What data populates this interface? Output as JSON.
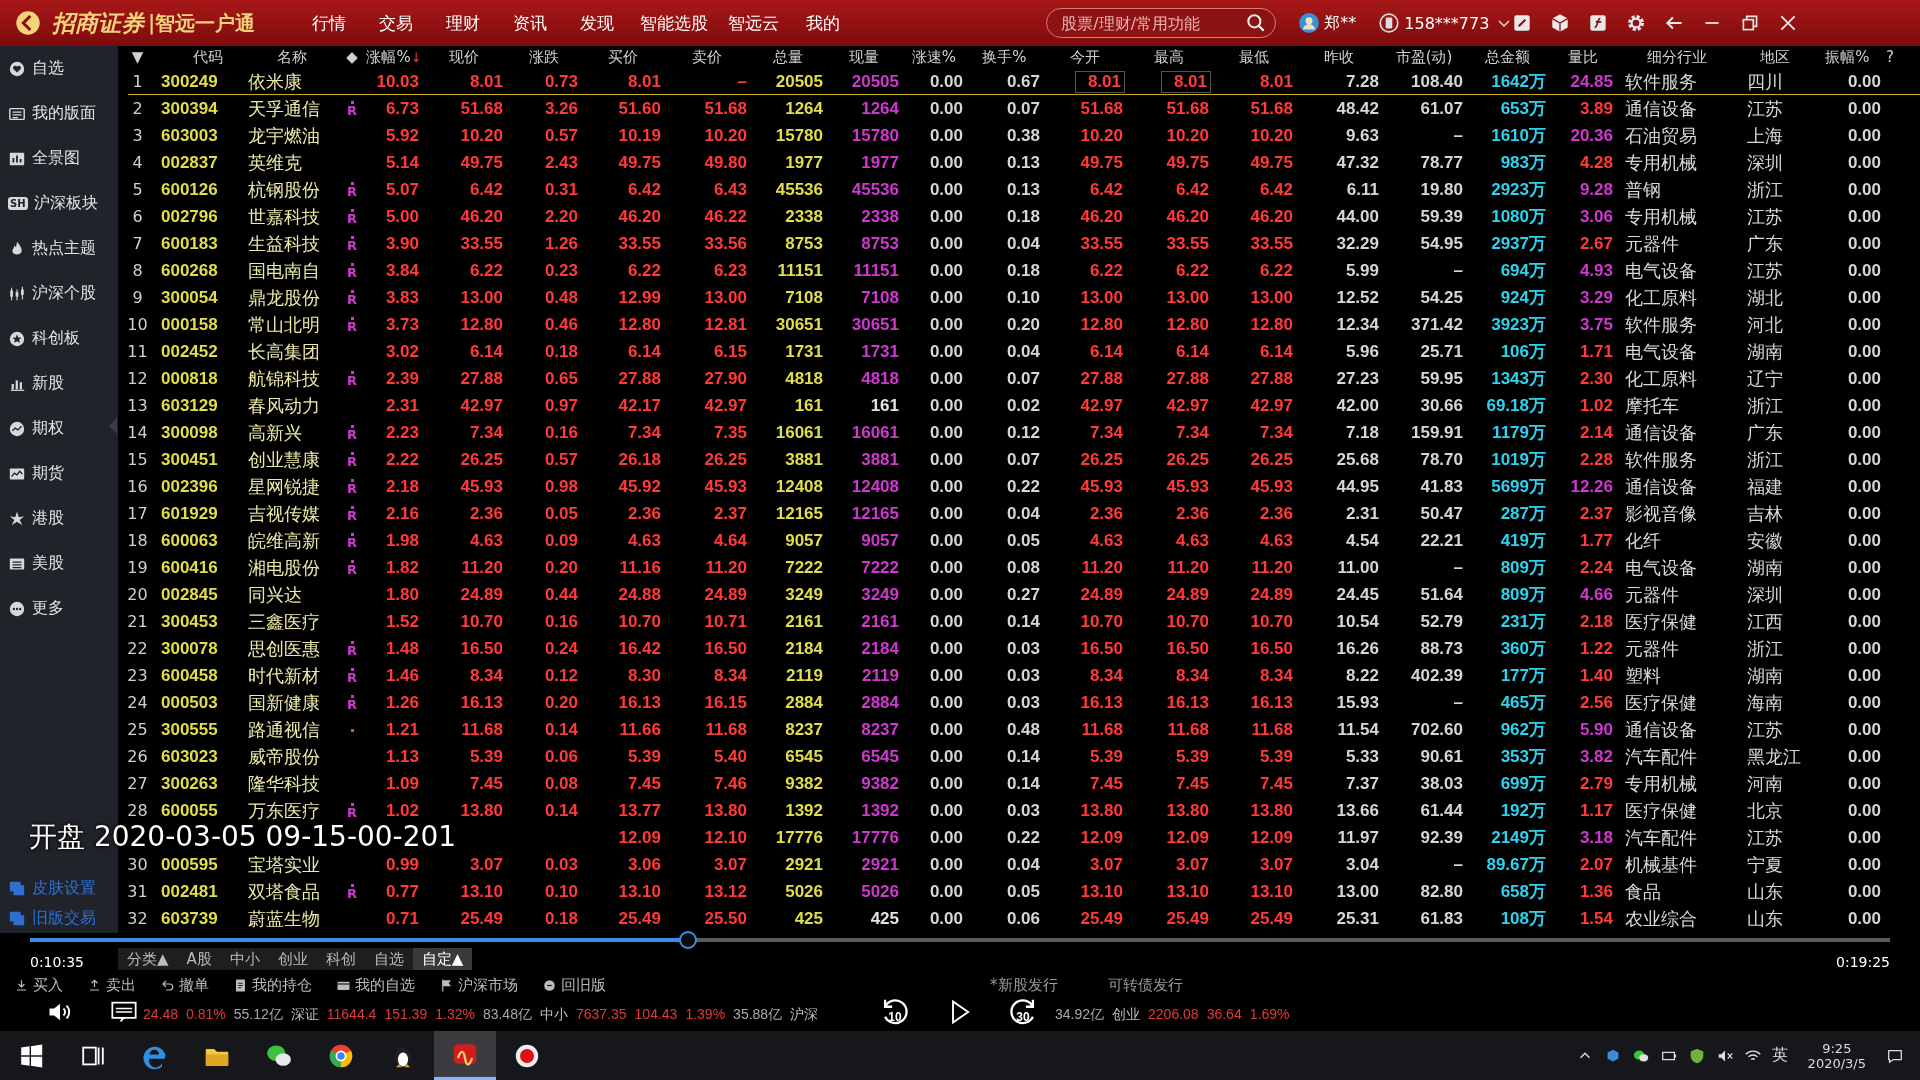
{
  "title_bar": {
    "brand": "招商证券",
    "product": "|智远一户通",
    "menu": [
      {
        "label": "行情",
        "selected": false
      },
      {
        "label": "交易",
        "selected": false
      },
      {
        "label": "理财",
        "selected": false
      },
      {
        "label": "资讯",
        "selected": false
      },
      {
        "label": "发现",
        "selected": false
      },
      {
        "label": "智能选股",
        "selected": false
      },
      {
        "label": "智远云",
        "selected": false
      },
      {
        "label": "我的",
        "selected": false
      }
    ],
    "search": {
      "placeholder": "股票/理财/常用功能"
    },
    "user": "郑**",
    "phone": "158***773"
  },
  "sidebar": {
    "items": [
      {
        "label": "自选",
        "kind": "heart"
      },
      {
        "label": "我的版面",
        "kind": "panel"
      },
      {
        "label": "全景图",
        "kind": "bars"
      },
      {
        "label": "沪深板块",
        "badge": "SH"
      },
      {
        "label": "热点主题",
        "kind": "flame"
      },
      {
        "label": "沪深个股",
        "kind": "candles"
      },
      {
        "label": "科创板",
        "kind": "star"
      },
      {
        "label": "新股",
        "kind": "chart"
      },
      {
        "label": "期权",
        "kind": "trend"
      },
      {
        "label": "期货",
        "kind": "area"
      },
      {
        "label": "港股",
        "kind": "flower"
      },
      {
        "label": "美股",
        "kind": "list"
      },
      {
        "label": "更多",
        "kind": "more"
      }
    ],
    "bottom_items": [
      {
        "label": "皮肤设置",
        "kind": "skin"
      },
      {
        "label": "旧版交易",
        "kind": "skin"
      }
    ]
  },
  "table": {
    "help": "?",
    "columns": [
      {
        "label": "▼",
        "kind": "rank"
      },
      {
        "label": "代码",
        "kind": "code"
      },
      {
        "label": "名称",
        "kind": "name"
      },
      {
        "label": "◆",
        "kind": "flag"
      },
      {
        "label": "涨幅%",
        "kind": "up",
        "sort": "↓"
      },
      {
        "label": "现价",
        "kind": "up"
      },
      {
        "label": "涨跌",
        "kind": "up"
      },
      {
        "label": "买价",
        "kind": "up"
      },
      {
        "label": "卖价",
        "kind": "up"
      },
      {
        "label": "总量",
        "kind": "volume"
      },
      {
        "label": "现量",
        "kind": "now"
      },
      {
        "label": "涨速%",
        "kind": "plain"
      },
      {
        "label": "换手%",
        "kind": "plain"
      },
      {
        "label": "今开",
        "kind": "up",
        "focus": true
      },
      {
        "label": "最高",
        "kind": "up",
        "focus": true
      },
      {
        "label": "最低",
        "kind": "up"
      },
      {
        "label": "昨收",
        "kind": "plain"
      },
      {
        "label": "市盈(动)",
        "kind": "plain"
      },
      {
        "label": "总金额",
        "kind": "amount"
      },
      {
        "label": "量比",
        "kind": "ratio"
      },
      {
        "label": "细分行业",
        "kind": "text"
      },
      {
        "label": "地区",
        "kind": "text"
      },
      {
        "label": "振幅%",
        "kind": "plain"
      }
    ],
    "rows": [
      {
        "cells": [
          "1",
          "300249",
          "依米康",
          "",
          "10.03",
          "8.01",
          "0.73",
          "8.01",
          "–",
          "20505",
          "20505",
          "0.00",
          "0.67",
          "8.01",
          "8.01",
          "8.01",
          "7.28",
          "108.40",
          "1642万",
          "24.85",
          "软件服务",
          "四川",
          "0.00"
        ],
        "selected": true,
        "dot": false,
        "now_flat": false,
        "ratio_high": true
      },
      {
        "cells": [
          "2",
          "300394",
          "天孚通信",
          "R",
          "6.73",
          "51.68",
          "3.26",
          "51.60",
          "51.68",
          "1264",
          "1264",
          "0.00",
          "0.07",
          "51.68",
          "51.68",
          "51.68",
          "48.42",
          "61.07",
          "653万",
          "3.89",
          "通信设备",
          "江苏",
          "0.00"
        ],
        "selected": false,
        "dot": true,
        "now_flat": false,
        "ratio_high": false
      },
      {
        "cells": [
          "3",
          "603003",
          "龙宇燃油",
          "",
          "5.92",
          "10.20",
          "0.57",
          "10.19",
          "10.20",
          "15780",
          "15780",
          "0.00",
          "0.38",
          "10.20",
          "10.20",
          "10.20",
          "9.63",
          "–",
          "1610万",
          "20.36",
          "石油贸易",
          "上海",
          "0.00"
        ],
        "selected": false,
        "dot": false,
        "now_flat": false,
        "ratio_high": true
      },
      {
        "cells": [
          "4",
          "002837",
          "英维克",
          "",
          "5.14",
          "49.75",
          "2.43",
          "49.75",
          "49.80",
          "1977",
          "1977",
          "0.00",
          "0.13",
          "49.75",
          "49.75",
          "49.75",
          "47.32",
          "78.77",
          "983万",
          "4.28",
          "专用机械",
          "深圳",
          "0.00"
        ],
        "selected": false,
        "dot": false,
        "now_flat": false,
        "ratio_high": false
      },
      {
        "cells": [
          "5",
          "600126",
          "杭钢股份",
          "R",
          "5.07",
          "6.42",
          "0.31",
          "6.42",
          "6.43",
          "45536",
          "45536",
          "0.00",
          "0.13",
          "6.42",
          "6.42",
          "6.42",
          "6.11",
          "19.80",
          "2923万",
          "9.28",
          "普钢",
          "浙江",
          "0.00"
        ],
        "selected": false,
        "dot": true,
        "now_flat": false,
        "ratio_high": true
      },
      {
        "cells": [
          "6",
          "002796",
          "世嘉科技",
          "R",
          "5.00",
          "46.20",
          "2.20",
          "46.20",
          "46.22",
          "2338",
          "2338",
          "0.00",
          "0.18",
          "46.20",
          "46.20",
          "46.20",
          "44.00",
          "59.39",
          "1080万",
          "3.06",
          "专用机械",
          "江苏",
          "0.00"
        ],
        "selected": false,
        "dot": true,
        "now_flat": false,
        "ratio_high": true
      },
      {
        "cells": [
          "7",
          "600183",
          "生益科技",
          "R",
          "3.90",
          "33.55",
          "1.26",
          "33.55",
          "33.56",
          "8753",
          "8753",
          "0.00",
          "0.04",
          "33.55",
          "33.55",
          "33.55",
          "32.29",
          "54.95",
          "2937万",
          "2.67",
          "元器件",
          "广东",
          "0.00"
        ],
        "selected": false,
        "dot": true,
        "now_flat": false,
        "ratio_high": false
      },
      {
        "cells": [
          "8",
          "600268",
          "国电南自",
          "R",
          "3.84",
          "6.22",
          "0.23",
          "6.22",
          "6.23",
          "11151",
          "11151",
          "0.00",
          "0.18",
          "6.22",
          "6.22",
          "6.22",
          "5.99",
          "–",
          "694万",
          "4.93",
          "电气设备",
          "江苏",
          "0.00"
        ],
        "selected": false,
        "dot": true,
        "now_flat": false,
        "ratio_high": true
      },
      {
        "cells": [
          "9",
          "300054",
          "鼎龙股份",
          "R",
          "3.83",
          "13.00",
          "0.48",
          "12.99",
          "13.00",
          "7108",
          "7108",
          "0.00",
          "0.10",
          "13.00",
          "13.00",
          "13.00",
          "12.52",
          "54.25",
          "924万",
          "3.29",
          "化工原料",
          "湖北",
          "0.00"
        ],
        "selected": false,
        "dot": true,
        "now_flat": false,
        "ratio_high": true
      },
      {
        "cells": [
          "10",
          "000158",
          "常山北明",
          "R",
          "3.73",
          "12.80",
          "0.46",
          "12.80",
          "12.81",
          "30651",
          "30651",
          "0.00",
          "0.20",
          "12.80",
          "12.80",
          "12.80",
          "12.34",
          "371.42",
          "3923万",
          "3.75",
          "软件服务",
          "河北",
          "0.00"
        ],
        "selected": false,
        "dot": true,
        "now_flat": false,
        "ratio_high": true
      },
      {
        "cells": [
          "11",
          "002452",
          "长高集团",
          "",
          "3.02",
          "6.14",
          "0.18",
          "6.14",
          "6.15",
          "1731",
          "1731",
          "0.00",
          "0.04",
          "6.14",
          "6.14",
          "6.14",
          "5.96",
          "25.71",
          "106万",
          "1.71",
          "电气设备",
          "湖南",
          "0.00"
        ],
        "selected": false,
        "dot": false,
        "now_flat": false,
        "ratio_high": false
      },
      {
        "cells": [
          "12",
          "000818",
          "航锦科技",
          "R",
          "2.39",
          "27.88",
          "0.65",
          "27.88",
          "27.90",
          "4818",
          "4818",
          "0.00",
          "0.07",
          "27.88",
          "27.88",
          "27.88",
          "27.23",
          "59.95",
          "1343万",
          "2.30",
          "化工原料",
          "辽宁",
          "0.00"
        ],
        "selected": false,
        "dot": true,
        "now_flat": false,
        "ratio_high": false
      },
      {
        "cells": [
          "13",
          "603129",
          "春风动力",
          "",
          "2.31",
          "42.97",
          "0.97",
          "42.17",
          "42.97",
          "161",
          "161",
          "0.00",
          "0.02",
          "42.97",
          "42.97",
          "42.97",
          "42.00",
          "30.66",
          "69.18万",
          "1.02",
          "摩托车",
          "浙江",
          "0.00"
        ],
        "selected": false,
        "dot": false,
        "now_flat": true,
        "ratio_high": false
      },
      {
        "cells": [
          "14",
          "300098",
          "高新兴",
          "R",
          "2.23",
          "7.34",
          "0.16",
          "7.34",
          "7.35",
          "16061",
          "16061",
          "0.00",
          "0.12",
          "7.34",
          "7.34",
          "7.34",
          "7.18",
          "159.91",
          "1179万",
          "2.14",
          "通信设备",
          "广东",
          "0.00"
        ],
        "selected": false,
        "dot": true,
        "now_flat": false,
        "ratio_high": false
      },
      {
        "cells": [
          "15",
          "300451",
          "创业慧康",
          "R",
          "2.22",
          "26.25",
          "0.57",
          "26.18",
          "26.25",
          "3881",
          "3881",
          "0.00",
          "0.07",
          "26.25",
          "26.25",
          "26.25",
          "25.68",
          "78.70",
          "1019万",
          "2.28",
          "软件服务",
          "浙江",
          "0.00"
        ],
        "selected": false,
        "dot": true,
        "now_flat": false,
        "ratio_high": false
      },
      {
        "cells": [
          "16",
          "002396",
          "星网锐捷",
          "R",
          "2.18",
          "45.93",
          "0.98",
          "45.92",
          "45.93",
          "12408",
          "12408",
          "0.00",
          "0.22",
          "45.93",
          "45.93",
          "45.93",
          "44.95",
          "41.83",
          "5699万",
          "12.26",
          "通信设备",
          "福建",
          "0.00"
        ],
        "selected": false,
        "dot": true,
        "now_flat": false,
        "ratio_high": true
      },
      {
        "cells": [
          "17",
          "601929",
          "吉视传媒",
          "R",
          "2.16",
          "2.36",
          "0.05",
          "2.36",
          "2.37",
          "12165",
          "12165",
          "0.00",
          "0.04",
          "2.36",
          "2.36",
          "2.36",
          "2.31",
          "50.47",
          "287万",
          "2.37",
          "影视音像",
          "吉林",
          "0.00"
        ],
        "selected": false,
        "dot": true,
        "now_flat": false,
        "ratio_high": false
      },
      {
        "cells": [
          "18",
          "600063",
          "皖维高新",
          "R",
          "1.98",
          "4.63",
          "0.09",
          "4.63",
          "4.64",
          "9057",
          "9057",
          "0.00",
          "0.05",
          "4.63",
          "4.63",
          "4.63",
          "4.54",
          "22.21",
          "419万",
          "1.77",
          "化纤",
          "安徽",
          "0.00"
        ],
        "selected": false,
        "dot": true,
        "now_flat": false,
        "ratio_high": false
      },
      {
        "cells": [
          "19",
          "600416",
          "湘电股份",
          "R",
          "1.82",
          "11.20",
          "0.20",
          "11.16",
          "11.20",
          "7222",
          "7222",
          "0.00",
          "0.08",
          "11.20",
          "11.20",
          "11.20",
          "11.00",
          "–",
          "809万",
          "2.24",
          "电气设备",
          "湖南",
          "0.00"
        ],
        "selected": false,
        "dot": true,
        "now_flat": false,
        "ratio_high": false
      },
      {
        "cells": [
          "20",
          "002845",
          "同兴达",
          "",
          "1.80",
          "24.89",
          "0.44",
          "24.88",
          "24.89",
          "3249",
          "3249",
          "0.00",
          "0.27",
          "24.89",
          "24.89",
          "24.89",
          "24.45",
          "51.64",
          "809万",
          "4.66",
          "元器件",
          "深圳",
          "0.00"
        ],
        "selected": false,
        "dot": false,
        "now_flat": false,
        "ratio_high": true
      },
      {
        "cells": [
          "21",
          "300453",
          "三鑫医疗",
          "",
          "1.52",
          "10.70",
          "0.16",
          "10.70",
          "10.71",
          "2161",
          "2161",
          "0.00",
          "0.14",
          "10.70",
          "10.70",
          "10.70",
          "10.54",
          "52.79",
          "231万",
          "2.18",
          "医疗保健",
          "江西",
          "0.00"
        ],
        "selected": false,
        "dot": false,
        "now_flat": false,
        "ratio_high": false
      },
      {
        "cells": [
          "22",
          "300078",
          "思创医惠",
          "R",
          "1.48",
          "16.50",
          "0.24",
          "16.42",
          "16.50",
          "2184",
          "2184",
          "0.00",
          "0.03",
          "16.50",
          "16.50",
          "16.50",
          "16.26",
          "88.73",
          "360万",
          "1.22",
          "元器件",
          "浙江",
          "0.00"
        ],
        "selected": false,
        "dot": true,
        "now_flat": false,
        "ratio_high": false
      },
      {
        "cells": [
          "23",
          "600458",
          "时代新材",
          "R",
          "1.46",
          "8.34",
          "0.12",
          "8.30",
          "8.34",
          "2119",
          "2119",
          "0.00",
          "0.03",
          "8.34",
          "8.34",
          "8.34",
          "8.22",
          "402.39",
          "177万",
          "1.40",
          "塑料",
          "湖南",
          "0.00"
        ],
        "selected": false,
        "dot": true,
        "now_flat": false,
        "ratio_high": false
      },
      {
        "cells": [
          "24",
          "000503",
          "国新健康",
          "R",
          "1.26",
          "16.13",
          "0.20",
          "16.13",
          "16.15",
          "2884",
          "2884",
          "0.00",
          "0.03",
          "16.13",
          "16.13",
          "16.13",
          "15.93",
          "–",
          "465万",
          "2.56",
          "医疗保健",
          "海南",
          "0.00"
        ],
        "selected": false,
        "dot": true,
        "now_flat": false,
        "ratio_high": false
      },
      {
        "cells": [
          "25",
          "300555",
          "路通视信",
          "",
          "1.21",
          "11.68",
          "0.14",
          "11.66",
          "11.68",
          "8237",
          "8237",
          "0.00",
          "0.48",
          "11.68",
          "11.68",
          "11.68",
          "11.54",
          "702.60",
          "962万",
          "5.90",
          "通信设备",
          "江苏",
          "0.00"
        ],
        "selected": false,
        "dot": true,
        "now_flat": false,
        "ratio_high": true
      },
      {
        "cells": [
          "26",
          "603023",
          "威帝股份",
          "",
          "1.13",
          "5.39",
          "0.06",
          "5.39",
          "5.40",
          "6545",
          "6545",
          "0.00",
          "0.14",
          "5.39",
          "5.39",
          "5.39",
          "5.33",
          "90.61",
          "353万",
          "3.82",
          "汽车配件",
          "黑龙江",
          "0.00"
        ],
        "selected": false,
        "dot": false,
        "now_flat": false,
        "ratio_high": true
      },
      {
        "cells": [
          "27",
          "300263",
          "隆华科技",
          "",
          "1.09",
          "7.45",
          "0.08",
          "7.45",
          "7.46",
          "9382",
          "9382",
          "0.00",
          "0.14",
          "7.45",
          "7.45",
          "7.45",
          "7.37",
          "38.03",
          "699万",
          "2.79",
          "专用机械",
          "河南",
          "0.00"
        ],
        "selected": false,
        "dot": false,
        "now_flat": false,
        "ratio_high": false
      },
      {
        "cells": [
          "28",
          "600055",
          "万东医疗",
          "R",
          "1.02",
          "13.80",
          "0.14",
          "13.77",
          "13.80",
          "1392",
          "1392",
          "0.00",
          "0.03",
          "13.80",
          "13.80",
          "13.80",
          "13.66",
          "61.44",
          "192万",
          "1.17",
          "医疗保健",
          "北京",
          "0.00"
        ],
        "selected": false,
        "dot": true,
        "now_flat": false,
        "ratio_high": false
      },
      {
        "cells": [
          null,
          null,
          null,
          null,
          null,
          null,
          null,
          "12.09",
          "12.10",
          "17776",
          "17776",
          "0.00",
          "0.22",
          "12.09",
          "12.09",
          "12.09",
          "11.97",
          "92.39",
          "2149万",
          "3.18",
          "汽车配件",
          "江苏",
          "0.00"
        ],
        "selected": false,
        "dot": false,
        "now_flat": false,
        "ratio_high": true
      },
      {
        "cells": [
          "30",
          "000595",
          "宝塔实业",
          "",
          "0.99",
          "3.07",
          "0.03",
          "3.06",
          "3.07",
          "2921",
          "2921",
          "0.00",
          "0.04",
          "3.07",
          "3.07",
          "3.07",
          "3.04",
          "–",
          "89.67万",
          "2.07",
          "机械基件",
          "宁夏",
          "0.00"
        ],
        "selected": false,
        "dot": false,
        "now_flat": false,
        "ratio_high": false
      },
      {
        "cells": [
          "31",
          "002481",
          "双塔食品",
          "R",
          "0.77",
          "13.10",
          "0.10",
          "13.10",
          "13.12",
          "5026",
          "5026",
          "0.00",
          "0.05",
          "13.10",
          "13.10",
          "13.10",
          "13.00",
          "82.80",
          "658万",
          "1.36",
          "食品",
          "山东",
          "0.00"
        ],
        "selected": false,
        "dot": true,
        "now_flat": false,
        "ratio_high": false
      },
      {
        "cells": [
          "32",
          "603739",
          "蔚蓝生物",
          "",
          "0.71",
          "25.49",
          "0.18",
          "25.49",
          "25.50",
          "425",
          "425",
          "0.00",
          "0.06",
          "25.49",
          "25.49",
          "25.49",
          "25.31",
          "61.83",
          "108万",
          "1.54",
          "农业综合",
          "山东",
          "0.00"
        ],
        "selected": false,
        "dot": false,
        "now_flat": true,
        "ratio_high": false
      }
    ]
  },
  "market_tabs": [
    {
      "label": "分类▲",
      "selected": false
    },
    {
      "label": "A股",
      "selected": false
    },
    {
      "label": "中小",
      "selected": false
    },
    {
      "label": "创业",
      "selected": false
    },
    {
      "label": "科创",
      "selected": false
    },
    {
      "label": "自选",
      "selected": false
    },
    {
      "label": "自定▲",
      "selected": true
    }
  ],
  "toolbar": [
    {
      "label": "买入",
      "kind": "buy"
    },
    {
      "label": "卖出",
      "kind": "sell"
    },
    {
      "label": "撤单",
      "kind": "undo"
    },
    {
      "label": "我的持仓",
      "kind": "doc"
    },
    {
      "label": "我的自选",
      "kind": "card"
    },
    {
      "label": "沪深市场",
      "kind": "flag"
    },
    {
      "label": "回旧版",
      "kind": "circle"
    }
  ],
  "news": [
    "*新股发行",
    "可转债发行"
  ],
  "status_bar": {
    "left": [
      {
        "text": "24.48",
        "kind": "up"
      },
      {
        "text": "0.81%",
        "kind": "up"
      },
      {
        "text": "55.12亿",
        "kind": "plain"
      },
      {
        "text": "深证",
        "kind": "label"
      },
      {
        "text": "11644.4",
        "kind": "up"
      },
      {
        "text": "151.39",
        "kind": "up"
      },
      {
        "text": "1.32%",
        "kind": "up"
      },
      {
        "text": "83.48亿",
        "kind": "plain"
      },
      {
        "text": "中小",
        "kind": "label"
      },
      {
        "text": "7637.35",
        "kind": "up"
      },
      {
        "text": "104.43",
        "kind": "up"
      },
      {
        "text": "1.39%",
        "kind": "up"
      },
      {
        "text": "35.88亿",
        "kind": "plain"
      },
      {
        "text": "沪深",
        "kind": "label"
      }
    ],
    "right": [
      {
        "text": "34.92亿",
        "kind": "plain"
      },
      {
        "text": "创业",
        "kind": "label"
      },
      {
        "text": "2206.08",
        "kind": "up"
      },
      {
        "text": "36.64",
        "kind": "up"
      },
      {
        "text": "1.69%",
        "kind": "up"
      }
    ]
  },
  "player": {
    "caption": "开盘 2020-03-05 09-15-00-201",
    "elapsed": "0:10:35",
    "duration": "0:19:25",
    "level": 0.354,
    "rewind": "10",
    "forward": "30"
  },
  "taskbar": {
    "apps": [
      {
        "kind": "windows",
        "selected": false
      },
      {
        "kind": "taskview",
        "selected": false
      },
      {
        "kind": "edge",
        "selected": false
      },
      {
        "kind": "folder",
        "selected": false
      },
      {
        "kind": "chat",
        "selected": false
      },
      {
        "kind": "browser",
        "selected": false
      },
      {
        "kind": "penguin",
        "selected": false
      },
      {
        "kind": "trading",
        "selected": true
      },
      {
        "kind": "record",
        "selected": false
      }
    ],
    "ime": "英",
    "time": "9:25",
    "date": "2020/3/5"
  }
}
